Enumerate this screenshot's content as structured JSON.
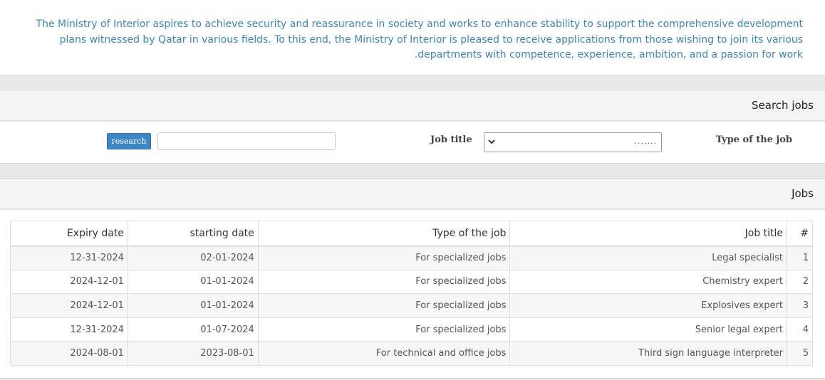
{
  "intro": {
    "text": "The Ministry of Interior aspires to achieve security and reassurance in society and works to enhance stability to support the comprehensive development plans witnessed by Qatar in various fields. To this end, the Ministry of Interior is pleased to receive applications from those wishing to join its various departments with competence, experience, ambition, and a passion for work."
  },
  "search": {
    "heading": "Search jobs",
    "type_label": "Type of the job",
    "type_select_value": ".......",
    "title_label": "Job title",
    "title_input_value": "",
    "button_label": "research"
  },
  "jobs": {
    "heading": "Jobs",
    "columns": {
      "num": "#",
      "title": "Job title",
      "type": "Type of the job",
      "start": "starting date",
      "expiry": "Expiry date"
    },
    "rows": [
      {
        "num": "1",
        "title": "Legal specialist",
        "type": "For specialized jobs",
        "start": "02-01-2024",
        "expiry": "12-31-2024"
      },
      {
        "num": "2",
        "title": "Chemistry expert",
        "type": "For specialized jobs",
        "start": "01-01-2024",
        "expiry": "2024-12-01"
      },
      {
        "num": "3",
        "title": "Explosives expert",
        "type": "For specialized jobs",
        "start": "01-01-2024",
        "expiry": "2024-12-01"
      },
      {
        "num": "4",
        "title": "Senior legal expert",
        "type": "For specialized jobs",
        "start": "01-07-2024",
        "expiry": "12-31-2024"
      },
      {
        "num": "5",
        "title": "Third sign language interpreter",
        "type": "For technical and office jobs",
        "start": "2023-08-01",
        "expiry": "2024-08-01"
      }
    ]
  },
  "colors": {
    "intro_text": "#3c86b8",
    "button": "#3c86c6",
    "page_bg": "#e9e9e9"
  }
}
